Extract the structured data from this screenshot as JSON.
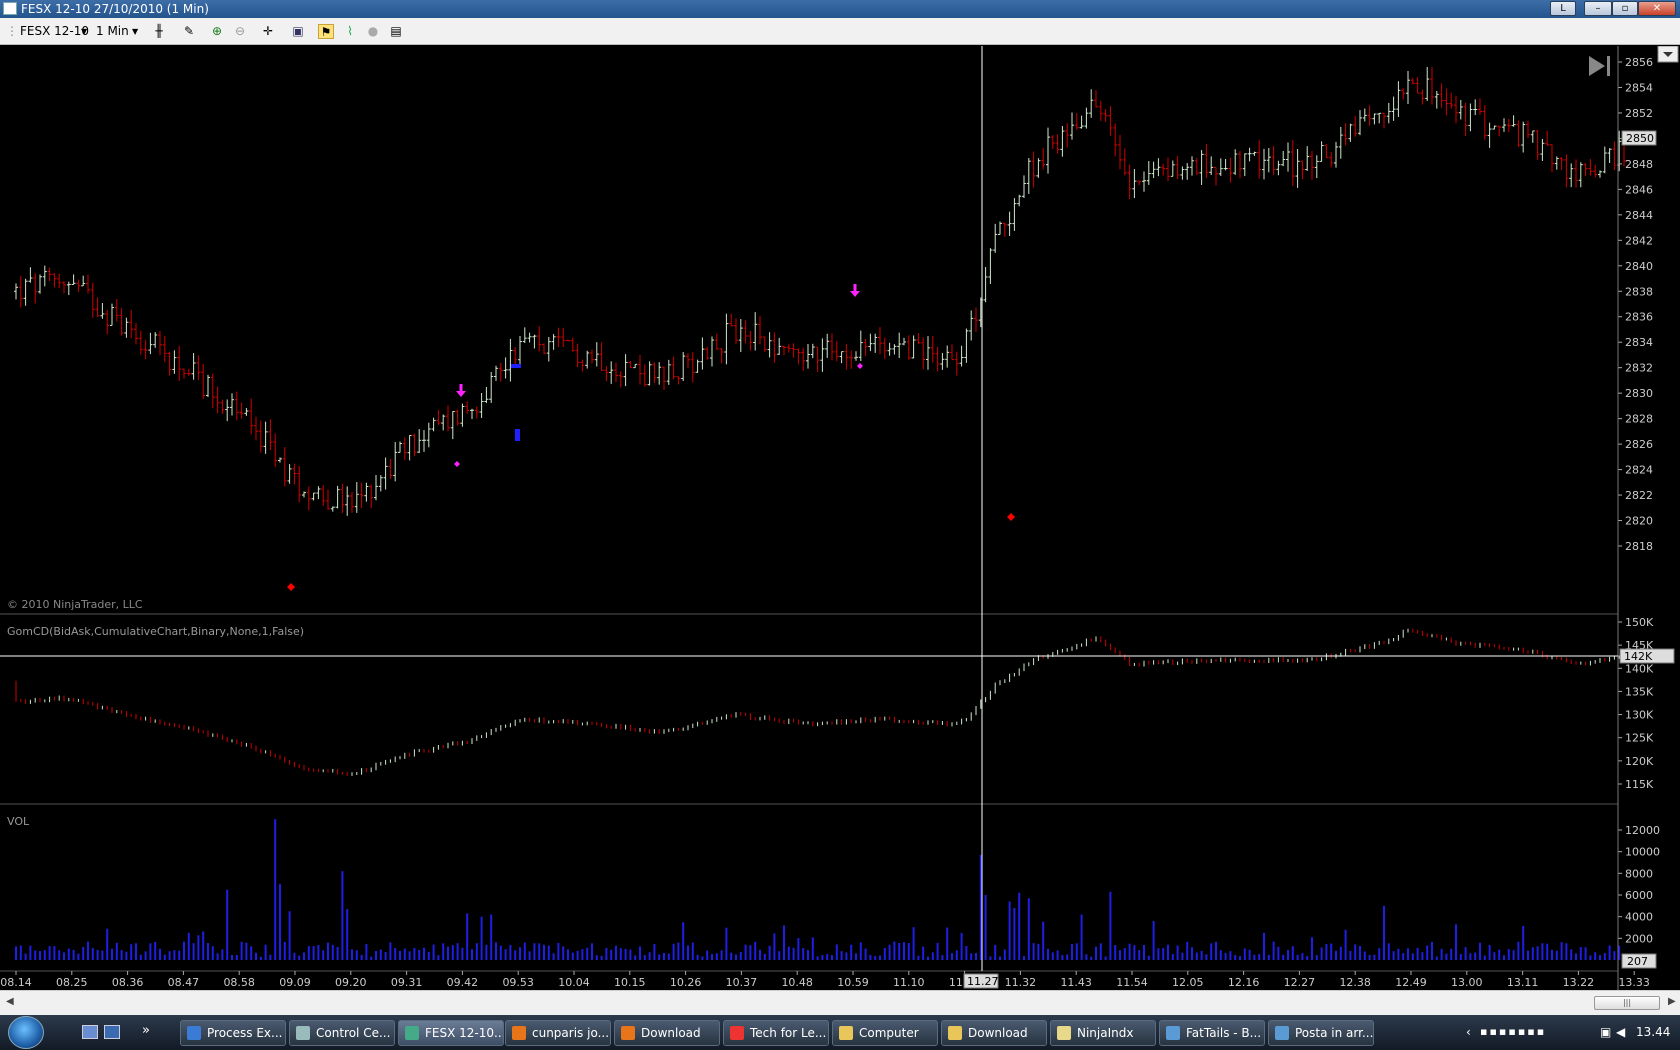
{
  "window": {
    "title": "FESX 12-10  27/10/2010 (1 Min)",
    "link_button": "L"
  },
  "toolbar": {
    "instrument": "FESX 12-10",
    "interval": "1 Min"
  },
  "price_panel": {
    "copyright": "© 2010 NinjaTrader, LLC",
    "y_ticks": [
      "2856",
      "2854",
      "2852",
      "2850",
      "2848",
      "2846",
      "2844",
      "2842",
      "2840",
      "2838",
      "2836",
      "2834",
      "2832",
      "2830",
      "2828",
      "2826",
      "2824",
      "2822",
      "2820",
      "2818"
    ],
    "last_price": "2850"
  },
  "cd_panel": {
    "label": "GomCD(BidAsk,CumulativeChart,Binary,None,1,False)",
    "y_ticks": [
      "150K",
      "145K",
      "140K",
      "135K",
      "130K",
      "125K",
      "120K",
      "115K"
    ],
    "marker": "142K"
  },
  "vol_panel": {
    "label": "VOL",
    "y_ticks": [
      "12000",
      "10000",
      "8000",
      "6000",
      "4000",
      "2000"
    ],
    "marker": "207"
  },
  "time_axis": {
    "ticks": [
      "08.14",
      "08.25",
      "08.36",
      "08.47",
      "08.58",
      "09.09",
      "09.20",
      "09.31",
      "09.42",
      "09.53",
      "10.04",
      "10.15",
      "10.26",
      "10.37",
      "10.48",
      "10.59",
      "11.10",
      "11.21",
      "11.32",
      "11.43",
      "11.54",
      "12.05",
      "12.16",
      "12.27",
      "12.38",
      "12.49",
      "13.00",
      "13.11",
      "13.22",
      "13.33"
    ],
    "cursor_time": "11.27"
  },
  "colors": {
    "up_bar": "#cfe8cf",
    "down_bar": "#d00000",
    "volume": "#1e1ee6",
    "signal_magenta": "#ff22ff",
    "signal_blue": "#2020ff",
    "signal_red": "#ff0000"
  },
  "taskbar": {
    "items": [
      {
        "label": "Process Ex...",
        "icon": "#3a7bd5"
      },
      {
        "label": "Control Ce...",
        "icon": "#9bb"
      },
      {
        "label": "FESX 12-10...",
        "icon": "#4a8",
        "active": true
      },
      {
        "label": "cunparis jo...",
        "icon": "#e8751a"
      },
      {
        "label": "Download",
        "icon": "#e8751a"
      },
      {
        "label": "Tech for Le...",
        "icon": "#e33"
      },
      {
        "label": "Computer",
        "icon": "#e8c65a"
      },
      {
        "label": "Download",
        "icon": "#e8c65a"
      },
      {
        "label": "NinjaIndx",
        "icon": "#e8d88a"
      },
      {
        "label": "FatTails - B...",
        "icon": "#5b9bd5"
      },
      {
        "label": "Posta in arr...",
        "icon": "#5b9bd5"
      }
    ],
    "clock": "13.44"
  }
}
